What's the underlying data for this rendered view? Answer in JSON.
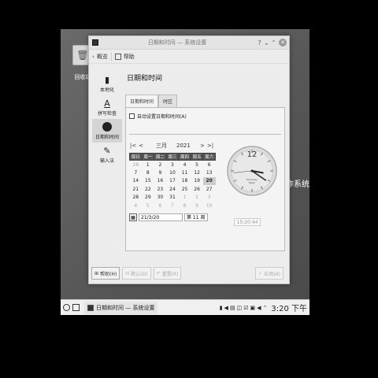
{
  "desktop": {
    "icon_label": "回收站",
    "side_text": "作系统"
  },
  "window": {
    "title": "日期和时间 — 系统设置"
  },
  "toolbar": {
    "back_label": "概览",
    "help_label": "帮助"
  },
  "sidebar": {
    "items": [
      {
        "label": "本地化",
        "icon": "flag-icon"
      },
      {
        "label": "拼写检查",
        "icon": "spell-icon"
      },
      {
        "label": "日期和时间",
        "icon": "clock-icon"
      },
      {
        "label": "输入法",
        "icon": "pen-icon"
      }
    ]
  },
  "page": {
    "title": "日期和时间"
  },
  "tabs": [
    "日期和时间",
    "时区"
  ],
  "auto_set": {
    "label": "自动设置日期和时间(A)",
    "checked": false
  },
  "calendar": {
    "prev_year": "|<",
    "prev_month": "<",
    "month": "三月",
    "year": "2021",
    "next_month": ">",
    "next_year": ">|",
    "weekdays": [
      "周日",
      "周一",
      "周二",
      "周三",
      "周四",
      "周五",
      "周六"
    ],
    "weeks": [
      [
        "28",
        "1",
        "2",
        "3",
        "4",
        "5",
        "6"
      ],
      [
        "7",
        "8",
        "9",
        "10",
        "11",
        "12",
        "13"
      ],
      [
        "14",
        "15",
        "16",
        "17",
        "18",
        "19",
        "20"
      ],
      [
        "21",
        "22",
        "23",
        "24",
        "25",
        "26",
        "27"
      ],
      [
        "28",
        "29",
        "30",
        "31",
        "1",
        "2",
        "3"
      ],
      [
        "4",
        "5",
        "6",
        "7",
        "8",
        "9",
        "10"
      ]
    ],
    "today": "20",
    "date_value": "21/3/20",
    "week_value": "第 11 周"
  },
  "clock": {
    "hour": 15,
    "minute": 20,
    "second": 44,
    "brand": "Kennsesy",
    "brand2": "Magn"
  },
  "time_value": "15:20:44",
  "buttons": {
    "help": "帮助(H)",
    "default": "默认(D)",
    "reset": "重置(R)",
    "apply": "应用(A)"
  },
  "taskbar": {
    "task_label": "日期和时间 — 系统设置",
    "time": "3:20 下午"
  }
}
